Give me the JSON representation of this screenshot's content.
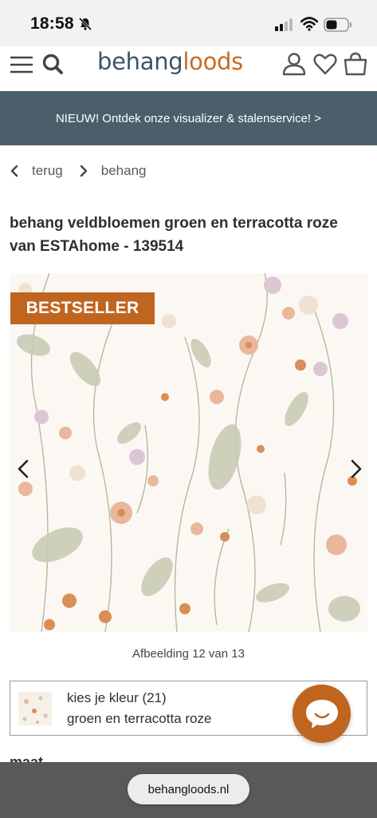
{
  "status_bar": {
    "time": "18:58"
  },
  "header": {
    "logo_part1": "behang",
    "logo_part2": "loods",
    "brand_color": "#c86b22",
    "logo_dark_color": "#3e5363",
    "icons": [
      "menu-icon",
      "search-icon",
      "account-icon",
      "heart-icon",
      "bag-icon"
    ]
  },
  "promo_banner": {
    "text": "NIEUW! Ontdek onze visualizer & stalenservice! >",
    "color": "#4b5f6b"
  },
  "breadcrumb": {
    "back_label": "terug",
    "category_label": "behang"
  },
  "product": {
    "title": "behang veldbloemen groen en terracotta roze van ESTAhome - 139514",
    "badge": "BESTSELLER",
    "badge_color": "#c0651f",
    "image_counter": "Afbeelding 12 van 13"
  },
  "color_selector": {
    "label": "kies je kleur (21)",
    "value": "groen en terracotta roze"
  },
  "section_peek": "maat",
  "browser": {
    "url": "behangloods.nl"
  }
}
